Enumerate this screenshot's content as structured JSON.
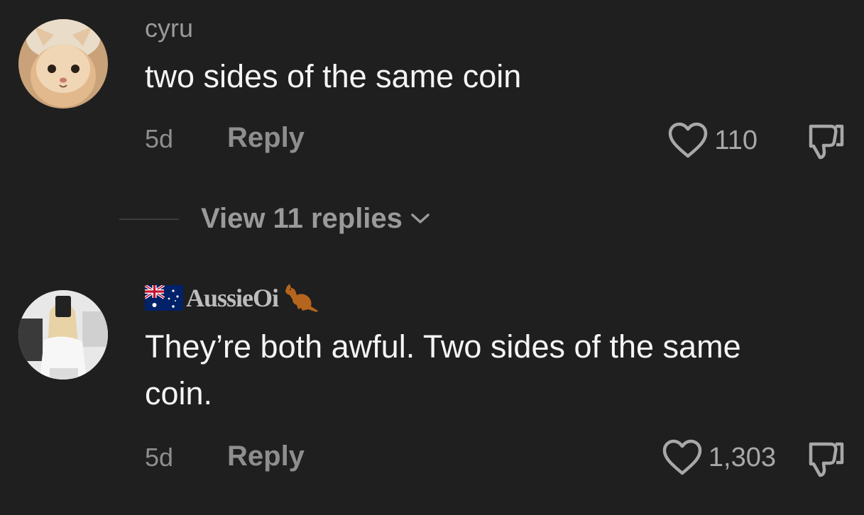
{
  "comments": [
    {
      "username": "cyru",
      "text": "two sides of the same coin",
      "time": "5d",
      "reply_label": "Reply",
      "likes": "110"
    },
    {
      "username": "AussieOi",
      "text": "They’re both awful. Two sides of the same coin.",
      "time": "5d",
      "reply_label": "Reply",
      "likes": "1,303"
    }
  ],
  "replies_toggle": {
    "label": "View 11 replies"
  },
  "icons": {
    "like": "heart-outline-icon",
    "dislike": "thumbs-down-icon",
    "expand": "chevron-down-icon",
    "flag": "australia-flag-icon",
    "kangaroo": "kangaroo-icon"
  },
  "colors": {
    "background": "#1f1f1f",
    "primary_text": "#f5f5f5",
    "secondary_text": "#9a9a9a"
  }
}
